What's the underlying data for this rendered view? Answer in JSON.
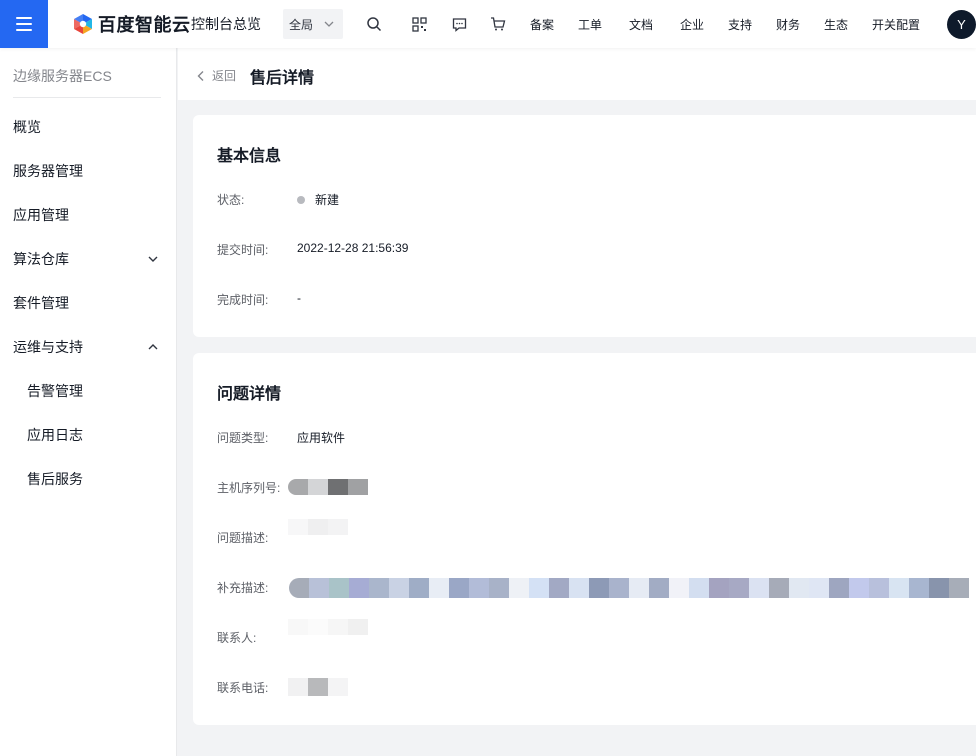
{
  "topbar": {
    "brand": "百度智能云",
    "console_title": "控制台总览",
    "scope_select": "全局",
    "nav_links": [
      "备案",
      "工单",
      "文档",
      "企业",
      "支持",
      "财务",
      "生态",
      "开关配置"
    ],
    "avatar_initial": "Y",
    "icons": [
      "search-icon",
      "qr-code-icon",
      "message-icon",
      "cart-icon"
    ]
  },
  "sidebar": {
    "title": "边缘服务器ECS",
    "items": [
      {
        "label": "概览"
      },
      {
        "label": "服务器管理"
      },
      {
        "label": "应用管理"
      },
      {
        "label": "算法仓库"
      },
      {
        "label": "套件管理"
      },
      {
        "label": "运维与支持"
      },
      {
        "label": "告警管理"
      },
      {
        "label": "应用日志"
      },
      {
        "label": "售后服务"
      }
    ]
  },
  "page": {
    "back_label": "返回",
    "title": "售后详情"
  },
  "basic_info": {
    "title": "基本信息",
    "status_label": "状态:",
    "status_value": "新建",
    "submit_time_label": "提交时间:",
    "submit_time_value": "2022-12-28 21:56:39",
    "complete_time_label": "完成时间:",
    "complete_time_value": "-"
  },
  "issue_detail": {
    "title": "问题详情",
    "type_label": "问题类型:",
    "type_value": "应用软件",
    "serial_label": "主机序列号:",
    "description_label": "问题描述:",
    "supplement_label": "补充描述:",
    "contact_label": "联系人:",
    "phone_label": "联系电话:"
  },
  "colors": {
    "accent": "#2468f2",
    "avatar_bg": "#0e1a2b",
    "status_new": "#b8babf"
  }
}
